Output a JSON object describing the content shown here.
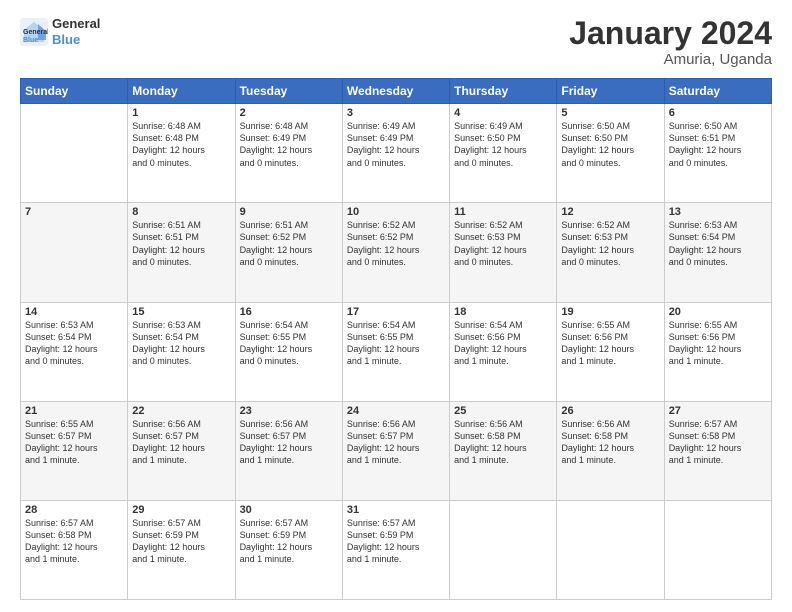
{
  "logo": {
    "line1": "General",
    "line2": "Blue"
  },
  "title": "January 2024",
  "subtitle": "Amuria, Uganda",
  "days_of_week": [
    "Sunday",
    "Monday",
    "Tuesday",
    "Wednesday",
    "Thursday",
    "Friday",
    "Saturday"
  ],
  "weeks": [
    [
      {
        "day": "",
        "info": ""
      },
      {
        "day": "1",
        "info": "Sunrise: 6:48 AM\nSunset: 6:48 PM\nDaylight: 12 hours\nand 0 minutes."
      },
      {
        "day": "2",
        "info": "Sunrise: 6:48 AM\nSunset: 6:49 PM\nDaylight: 12 hours\nand 0 minutes."
      },
      {
        "day": "3",
        "info": "Sunrise: 6:49 AM\nSunset: 6:49 PM\nDaylight: 12 hours\nand 0 minutes."
      },
      {
        "day": "4",
        "info": "Sunrise: 6:49 AM\nSunset: 6:50 PM\nDaylight: 12 hours\nand 0 minutes."
      },
      {
        "day": "5",
        "info": "Sunrise: 6:50 AM\nSunset: 6:50 PM\nDaylight: 12 hours\nand 0 minutes."
      },
      {
        "day": "6",
        "info": "Sunrise: 6:50 AM\nSunset: 6:51 PM\nDaylight: 12 hours\nand 0 minutes."
      }
    ],
    [
      {
        "day": "7",
        "info": ""
      },
      {
        "day": "8",
        "info": "Sunrise: 6:51 AM\nSunset: 6:51 PM\nDaylight: 12 hours\nand 0 minutes."
      },
      {
        "day": "9",
        "info": "Sunrise: 6:51 AM\nSunset: 6:52 PM\nDaylight: 12 hours\nand 0 minutes."
      },
      {
        "day": "10",
        "info": "Sunrise: 6:52 AM\nSunset: 6:52 PM\nDaylight: 12 hours\nand 0 minutes."
      },
      {
        "day": "11",
        "info": "Sunrise: 6:52 AM\nSunset: 6:53 PM\nDaylight: 12 hours\nand 0 minutes."
      },
      {
        "day": "12",
        "info": "Sunrise: 6:52 AM\nSunset: 6:53 PM\nDaylight: 12 hours\nand 0 minutes."
      },
      {
        "day": "13",
        "info": "Sunrise: 6:53 AM\nSunset: 6:54 PM\nDaylight: 12 hours\nand 0 minutes."
      }
    ],
    [
      {
        "day": "14",
        "info": "Sunrise: 6:53 AM\nSunset: 6:54 PM\nDaylight: 12 hours\nand 0 minutes."
      },
      {
        "day": "15",
        "info": "Sunrise: 6:53 AM\nSunset: 6:54 PM\nDaylight: 12 hours\nand 0 minutes."
      },
      {
        "day": "16",
        "info": "Sunrise: 6:54 AM\nSunset: 6:55 PM\nDaylight: 12 hours\nand 0 minutes."
      },
      {
        "day": "17",
        "info": "Sunrise: 6:54 AM\nSunset: 6:55 PM\nDaylight: 12 hours\nand 1 minute."
      },
      {
        "day": "18",
        "info": "Sunrise: 6:54 AM\nSunset: 6:56 PM\nDaylight: 12 hours\nand 1 minute."
      },
      {
        "day": "19",
        "info": "Sunrise: 6:55 AM\nSunset: 6:56 PM\nDaylight: 12 hours\nand 1 minute."
      },
      {
        "day": "20",
        "info": "Sunrise: 6:55 AM\nSunset: 6:56 PM\nDaylight: 12 hours\nand 1 minute."
      }
    ],
    [
      {
        "day": "21",
        "info": "Sunrise: 6:55 AM\nSunset: 6:57 PM\nDaylight: 12 hours\nand 1 minute."
      },
      {
        "day": "22",
        "info": "Sunrise: 6:56 AM\nSunset: 6:57 PM\nDaylight: 12 hours\nand 1 minute."
      },
      {
        "day": "23",
        "info": "Sunrise: 6:56 AM\nSunset: 6:57 PM\nDaylight: 12 hours\nand 1 minute."
      },
      {
        "day": "24",
        "info": "Sunrise: 6:56 AM\nSunset: 6:57 PM\nDaylight: 12 hours\nand 1 minute."
      },
      {
        "day": "25",
        "info": "Sunrise: 6:56 AM\nSunset: 6:58 PM\nDaylight: 12 hours\nand 1 minute."
      },
      {
        "day": "26",
        "info": "Sunrise: 6:56 AM\nSunset: 6:58 PM\nDaylight: 12 hours\nand 1 minute."
      },
      {
        "day": "27",
        "info": "Sunrise: 6:57 AM\nSunset: 6:58 PM\nDaylight: 12 hours\nand 1 minute."
      }
    ],
    [
      {
        "day": "28",
        "info": "Sunrise: 6:57 AM\nSunset: 6:58 PM\nDaylight: 12 hours\nand 1 minute."
      },
      {
        "day": "29",
        "info": "Sunrise: 6:57 AM\nSunset: 6:59 PM\nDaylight: 12 hours\nand 1 minute."
      },
      {
        "day": "30",
        "info": "Sunrise: 6:57 AM\nSunset: 6:59 PM\nDaylight: 12 hours\nand 1 minute."
      },
      {
        "day": "31",
        "info": "Sunrise: 6:57 AM\nSunset: 6:59 PM\nDaylight: 12 hours\nand 1 minute."
      },
      {
        "day": "",
        "info": ""
      },
      {
        "day": "",
        "info": ""
      },
      {
        "day": "",
        "info": ""
      }
    ]
  ]
}
